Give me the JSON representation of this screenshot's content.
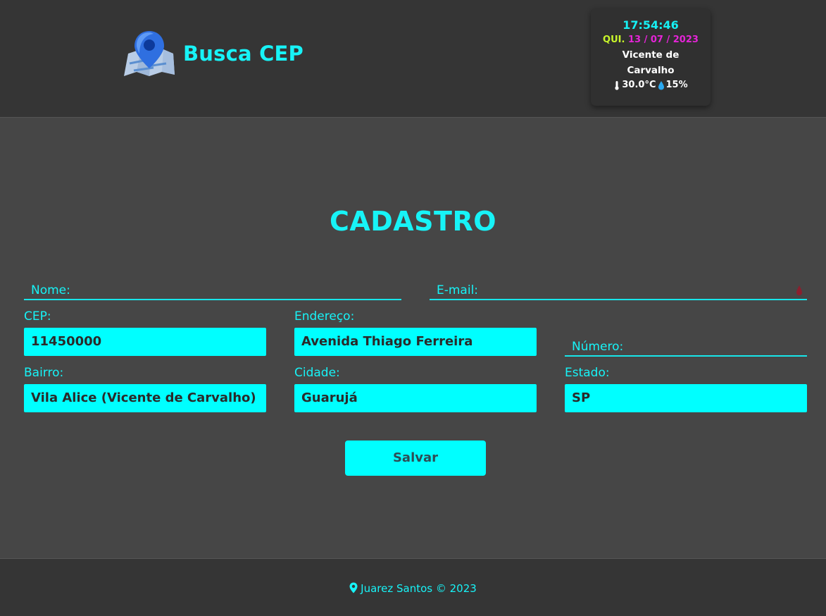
{
  "header": {
    "app_title": "Busca CEP",
    "logo_icon": "map-pin-icon"
  },
  "widget": {
    "time": "17:54:46",
    "weekday": "QUI.",
    "date": "13 / 07 / 2023",
    "city": "Vicente de Carvalho",
    "temperature": "30.0°C",
    "humidity": "15%",
    "thermometer_icon": "thermometer-icon",
    "humidity_icon": "water-drop-icon"
  },
  "main": {
    "title": "CADASTRO",
    "nome": {
      "label": "Nome:",
      "value": ""
    },
    "email": {
      "label": "E-mail:",
      "value": ""
    },
    "cep": {
      "label": "CEP:",
      "value": "11450000"
    },
    "endereco": {
      "label": "Endereço:",
      "value": "Avenida Thiago Ferreira"
    },
    "numero": {
      "label": "Número:",
      "value": ""
    },
    "bairro": {
      "label": "Bairro:",
      "value": "Vila Alice (Vicente de Carvalho)"
    },
    "cidade": {
      "label": "Cidade:",
      "value": "Guarujá"
    },
    "estado": {
      "label": "Estado:",
      "value": "SP"
    },
    "save_label": "Salvar"
  },
  "footer": {
    "text": "Juarez Santos © 2023",
    "icon": "location-pin-icon"
  },
  "colors": {
    "accent": "#00ffff",
    "header_bg": "#353535",
    "body_bg": "#464646",
    "weekday": "#c8f52a",
    "date": "#e524d7"
  }
}
